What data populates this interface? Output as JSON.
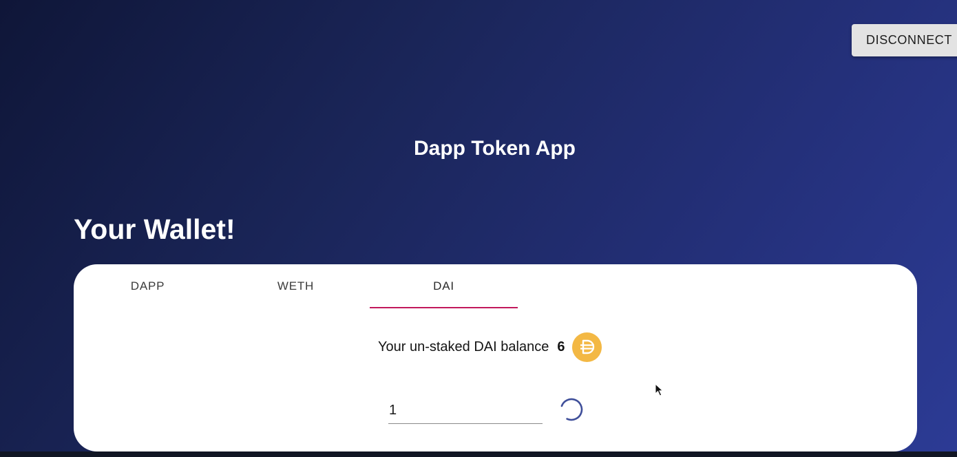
{
  "header": {
    "disconnect_label": "DISCONNECT",
    "app_title": "Dapp Token App"
  },
  "wallet": {
    "title": "Your Wallet!",
    "tabs": [
      {
        "label": "DAPP",
        "active": false
      },
      {
        "label": "WETH",
        "active": false
      },
      {
        "label": "DAI",
        "active": true
      }
    ],
    "balance_label": "Your un-staked DAI balance",
    "balance_value": "6",
    "token_icon": "dai-token-icon",
    "amount_input_value": "1",
    "loading": true
  },
  "colors": {
    "tab_indicator": "#c2185b",
    "dai_icon": "#f3b844",
    "spinner": "#3f4f9a"
  }
}
